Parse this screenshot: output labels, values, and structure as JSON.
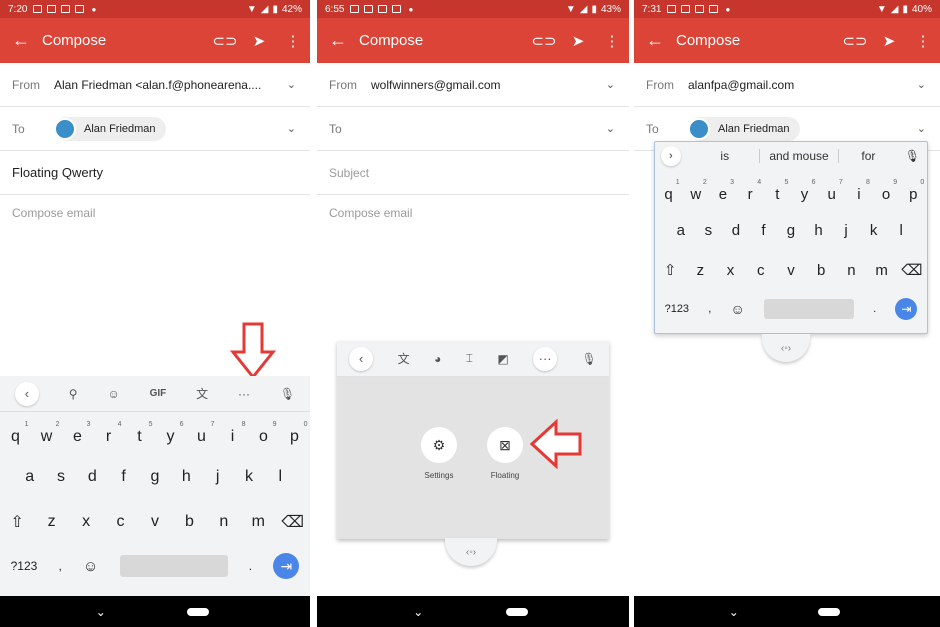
{
  "phones": [
    {
      "status": {
        "time": "7:20",
        "battery": "42%"
      },
      "appbar": {
        "title": "Compose"
      },
      "from": {
        "label": "From",
        "value": "Alan Friedman <alan.f@phonearena...."
      },
      "to": {
        "label": "To",
        "chip": "Alan Friedman"
      },
      "subject": {
        "value": "Floating Qwerty"
      },
      "body": {
        "placeholder": "Compose email"
      },
      "keyboard": {
        "gif": "GIF",
        "more": "···",
        "row1": [
          "q",
          "w",
          "e",
          "r",
          "t",
          "y",
          "u",
          "i",
          "o",
          "p"
        ],
        "row1_nums": [
          "1",
          "2",
          "3",
          "4",
          "5",
          "6",
          "7",
          "8",
          "9",
          "0"
        ],
        "row2": [
          "a",
          "s",
          "d",
          "f",
          "g",
          "h",
          "j",
          "k",
          "l"
        ],
        "row3": [
          "z",
          "x",
          "c",
          "v",
          "b",
          "n",
          "m"
        ],
        "sym": "?123",
        "comma": ",",
        "period": "."
      }
    },
    {
      "status": {
        "time": "6:55",
        "battery": "43%"
      },
      "appbar": {
        "title": "Compose"
      },
      "from": {
        "label": "From",
        "value": "wolfwinners@gmail.com"
      },
      "to": {
        "label": "To"
      },
      "subject": {
        "placeholder": "Subject"
      },
      "body": {
        "placeholder": "Compose email"
      },
      "options": {
        "settings": "Settings",
        "floating": "Floating"
      }
    },
    {
      "status": {
        "time": "7:31",
        "battery": "40%"
      },
      "appbar": {
        "title": "Compose"
      },
      "from": {
        "label": "From",
        "value": "alanfpa@gmail.com"
      },
      "to": {
        "label": "To",
        "chip": "Alan Friedman"
      },
      "keyboard": {
        "suggestions": [
          "is",
          "and mouse",
          "for"
        ],
        "row1": [
          "q",
          "w",
          "e",
          "r",
          "t",
          "y",
          "u",
          "i",
          "o",
          "p"
        ],
        "row1_nums": [
          "1",
          "2",
          "3",
          "4",
          "5",
          "6",
          "7",
          "8",
          "9",
          "0"
        ],
        "row2": [
          "a",
          "s",
          "d",
          "f",
          "g",
          "h",
          "j",
          "k",
          "l"
        ],
        "row3": [
          "z",
          "x",
          "c",
          "v",
          "b",
          "n",
          "m"
        ],
        "sym": "?123",
        "comma": ",",
        "period": "."
      }
    }
  ],
  "colors": {
    "statusbar": "#c7362c",
    "appbar": "#db4437",
    "accent_blue": "#4a86e8",
    "arrow": "#e53935"
  },
  "icons": {
    "back": "arrow-left-icon",
    "attach": "paperclip-icon",
    "send": "send-icon",
    "menu": "more-vert-icon",
    "mic": "mic-icon"
  }
}
